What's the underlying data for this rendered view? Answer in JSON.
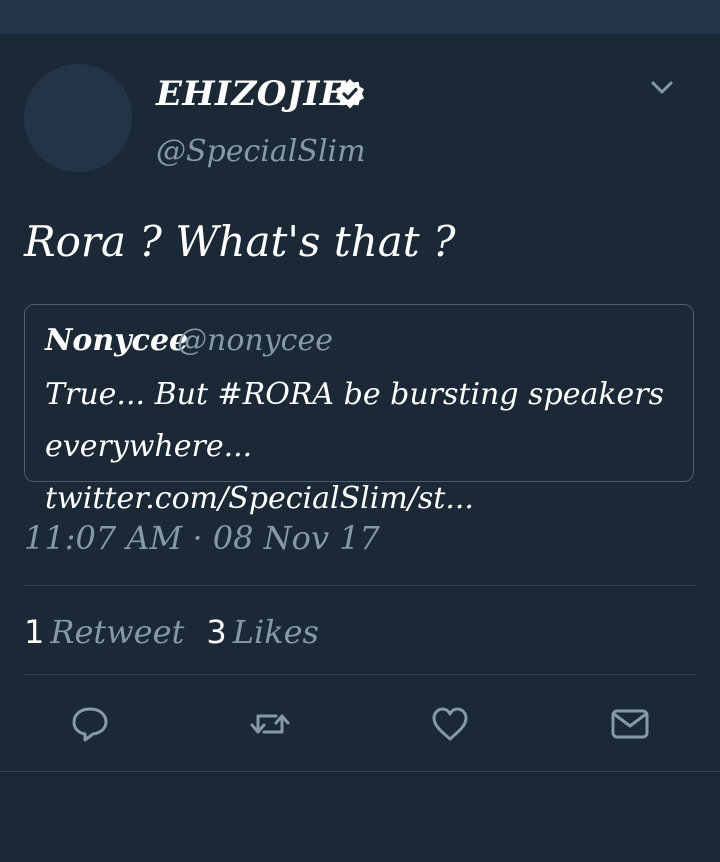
{
  "tweet": {
    "author": {
      "display_name": "EHIZOJIE",
      "handle": "@SpecialSlim",
      "verified_icon": "verified-badge-icon"
    },
    "text": "Rora ? What's that ?",
    "quoted_tweet": {
      "display_name": "Nonycee",
      "handle": "@nonycee",
      "text_line1": "True...  But #RORA be bursting speakers",
      "text_line2": "everywhere... twitter.com/SpecialSlim/st..."
    },
    "timestamp": "11:07 AM · 08 Nov 17",
    "stats": {
      "retweets_count": "1",
      "retweets_label": "Retweet",
      "likes_count": "3",
      "likes_label": "Likes"
    },
    "actions": [
      "reply-icon",
      "retweet-icon",
      "like-icon",
      "message-icon"
    ]
  },
  "colors": {
    "background": "#1b2836",
    "status_bar": "#243447",
    "secondary_text": "#8899a6",
    "divider": "#38444d"
  }
}
